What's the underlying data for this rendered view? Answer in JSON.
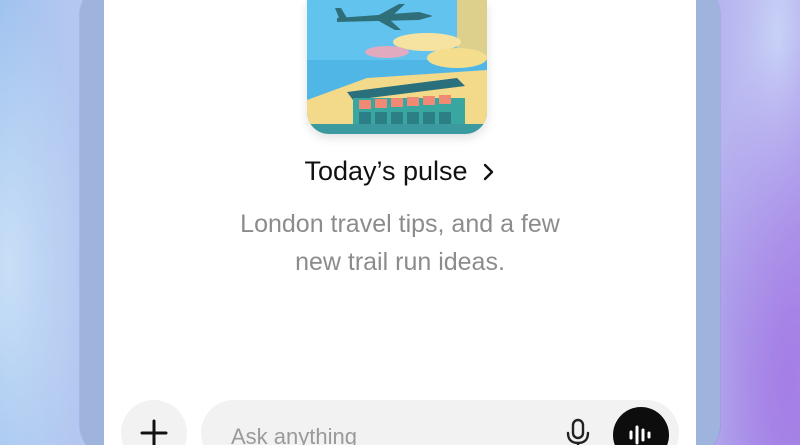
{
  "pulse": {
    "illustration_label": "London travel illustration",
    "title": "Today’s pulse",
    "chevron_icon": "chevron-right-icon",
    "subtitle_lines": [
      "London travel tips, and a few",
      "new trail run ideas."
    ]
  },
  "composer": {
    "add_icon": "plus-icon",
    "placeholder": "Ask anything",
    "mic_icon": "microphone-icon",
    "voice_icon": "voice-waveform-icon"
  },
  "colors": {
    "title": "#111111",
    "subtitle": "#8c8c8c",
    "composer_bg": "#f2f2f2",
    "voice_button": "#0d0d0d",
    "frame": "#9fb4dd"
  }
}
